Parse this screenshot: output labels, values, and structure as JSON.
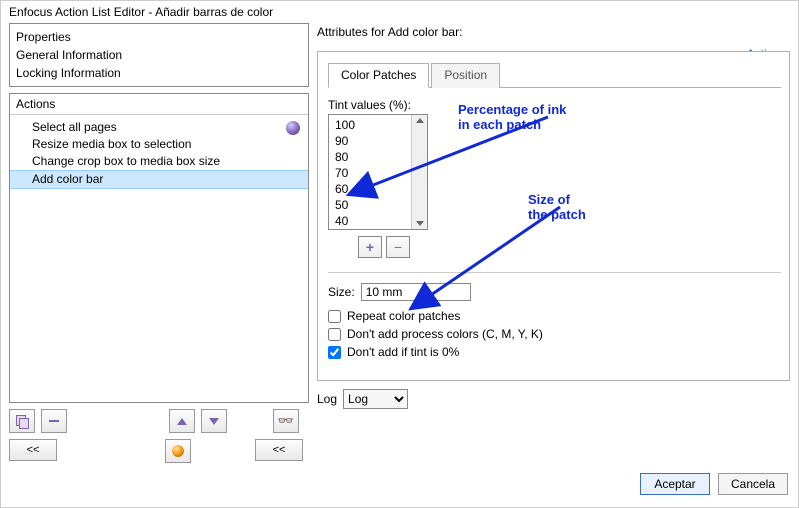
{
  "window": {
    "title": "Enfocus Action List Editor - Añadir barras de color"
  },
  "properties": {
    "header": "Properties",
    "items": [
      "General Information",
      "Locking Information"
    ]
  },
  "actions_panel": {
    "header": "Actions",
    "items": [
      "Select all pages",
      "Resize media box to selection",
      "Change crop box to media box size",
      "Add color bar"
    ],
    "selected_index": 3
  },
  "right": {
    "attributes_label": "Attributes for Add color bar:",
    "actions_link": "Actions",
    "tabs": {
      "patches": "Color Patches",
      "position": "Position",
      "active": "patches"
    },
    "tint_label": "Tint values (%):",
    "tint_values": [
      "100",
      "90",
      "80",
      "70",
      "60",
      "50",
      "40"
    ],
    "size_label": "Size:",
    "size_value": "10 mm",
    "check_repeat": "Repeat color patches",
    "check_no_process": "Don't add process colors (C, M, Y, K)",
    "check_no_zero": "Don't add if tint is 0%",
    "log_label": "Log",
    "log_value": "Log"
  },
  "annotations": {
    "ink": "Percentage of ink\nin each patch",
    "size": "Size of\nthe patch"
  },
  "buttons": {
    "plus": "+",
    "minus": "−",
    "rewind": "<<",
    "accept": "Aceptar",
    "cancel": "Cancela"
  }
}
